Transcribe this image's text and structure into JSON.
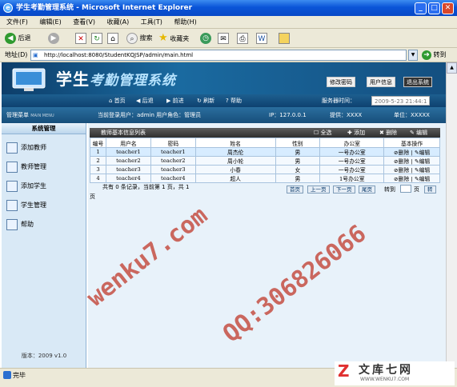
{
  "window": {
    "title": "学生考勤管理系统 - Microsoft Internet Explorer",
    "min": "_",
    "max": "□",
    "close": "✕"
  },
  "menu": [
    "文件(F)",
    "编辑(E)",
    "查看(V)",
    "收藏(A)",
    "工具(T)",
    "帮助(H)"
  ],
  "toolbar": {
    "back": "后退",
    "search": "搜索",
    "favorites": "收藏夹"
  },
  "address": {
    "label": "地址(D)",
    "url": "http://localhost:8080/StudentKQJSP/admin/main.html",
    "go": "转到"
  },
  "banner": {
    "title_a": "学生",
    "title_b": "考勤管理系统",
    "btn_pwd": "修改密码",
    "btn_user": "用户信息",
    "btn_exit": "退出系统"
  },
  "nav": {
    "home": "首页",
    "back": "后退",
    "forward": "前进",
    "refresh": "刷新",
    "help": "帮助",
    "time_label": "服务器时间：",
    "time_value": "2009-5-23 21:44:1"
  },
  "info": {
    "menu_label": "管理菜单",
    "menu_en": "MAIN MENU",
    "login_user": "当前登录用户：admin  用户角色：管理员",
    "ip": "IP：127.0.0.1",
    "provider": "提供：XXXX",
    "unit": "单位：XXXXX"
  },
  "sidebar": {
    "head": "系统管理",
    "items": [
      "添加教师",
      "教师管理",
      "添加学生",
      "学生管理",
      "帮助"
    ],
    "version": "版本：2009 v1.0"
  },
  "table": {
    "title": "教师基本信息列表",
    "actions": {
      "select_all": "全选",
      "add": "添加",
      "delete": "删除",
      "edit": "编辑"
    },
    "headers": [
      "编号",
      "用户名",
      "密码",
      "姓名",
      "性别",
      "办公室",
      "基本操作"
    ],
    "rows": [
      {
        "id": "1",
        "username": "teacher1",
        "password": "teacher1",
        "name": "周杰伦",
        "sex": "男",
        "office": "一号办公室",
        "del": "删除",
        "edit": "编辑"
      },
      {
        "id": "2",
        "username": "teacher2",
        "password": "teacher2",
        "name": "周小轮",
        "sex": "男",
        "office": "一号办公室",
        "del": "删除",
        "edit": "编辑"
      },
      {
        "id": "3",
        "username": "teacher3",
        "password": "teacher3",
        "name": "小春",
        "sex": "女",
        "office": "一号办公室",
        "del": "删除",
        "edit": "编辑"
      },
      {
        "id": "4",
        "username": "teacher4",
        "password": "teacher4",
        "name": "超人",
        "sex": "男",
        "office": "1号办公室",
        "del": "删除",
        "edit": "编辑"
      }
    ]
  },
  "pager": {
    "summary": "共有 0 条记录，当前第 1 页，共 1",
    "unit": "页",
    "first": "首页",
    "prev": "上一页",
    "next": "下一页",
    "last": "尾页",
    "goto": "转到",
    "page": "页",
    "go": "转"
  },
  "status": {
    "text": "完毕"
  },
  "watermarks": {
    "a": "wenku7.com",
    "b": "QQ:306826066",
    "logo_cn": "文库七网",
    "logo_en": "WWW.WENKU7.COM"
  }
}
